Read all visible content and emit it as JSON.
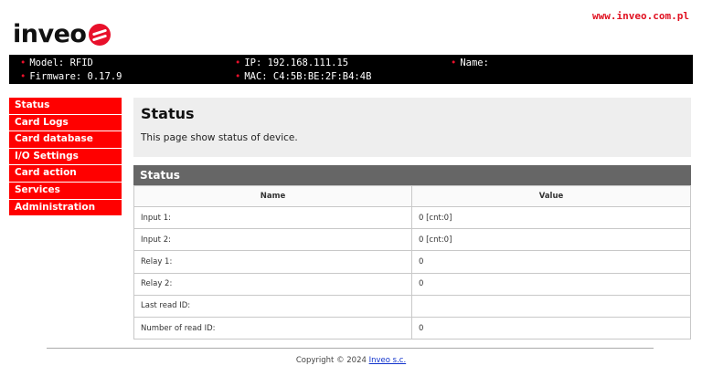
{
  "brand": {
    "logo_text": "inveo",
    "site_link": "www.inveo.com.pl"
  },
  "infobar": {
    "model": "Model: RFID",
    "firmware": "Firmware: 0.17.9",
    "ip": "IP: 192.168.111.15",
    "mac": "MAC: C4:5B:BE:2F:B4:4B",
    "name": "Name:"
  },
  "menu": {
    "items": [
      {
        "label": "Status"
      },
      {
        "label": "Card Logs"
      },
      {
        "label": "Card database"
      },
      {
        "label": "I/O Settings"
      },
      {
        "label": "Card action"
      },
      {
        "label": "Services"
      },
      {
        "label": "Administration"
      }
    ]
  },
  "intro": {
    "title": "Status",
    "description": "This page show status of device."
  },
  "status_table": {
    "header": "Status",
    "columns": [
      "Name",
      "Value"
    ],
    "rows": [
      {
        "name": "Input 1:",
        "value": "0 [cnt:0]"
      },
      {
        "name": "Input 2:",
        "value": "0 [cnt:0]"
      },
      {
        "name": "Relay 1:",
        "value": "0"
      },
      {
        "name": "Relay 2:",
        "value": "0"
      },
      {
        "name": "Last read ID:",
        "value": ""
      },
      {
        "name": "Number of read ID:",
        "value": "0"
      }
    ]
  },
  "footer": {
    "copyright": "Copyright © 2024 ",
    "company": "Inveo s.c."
  },
  "colors": {
    "accent": "#ff0000",
    "infobar_bg": "#000000",
    "panel_header": "#666666",
    "intro_bg": "#eeeeee"
  }
}
